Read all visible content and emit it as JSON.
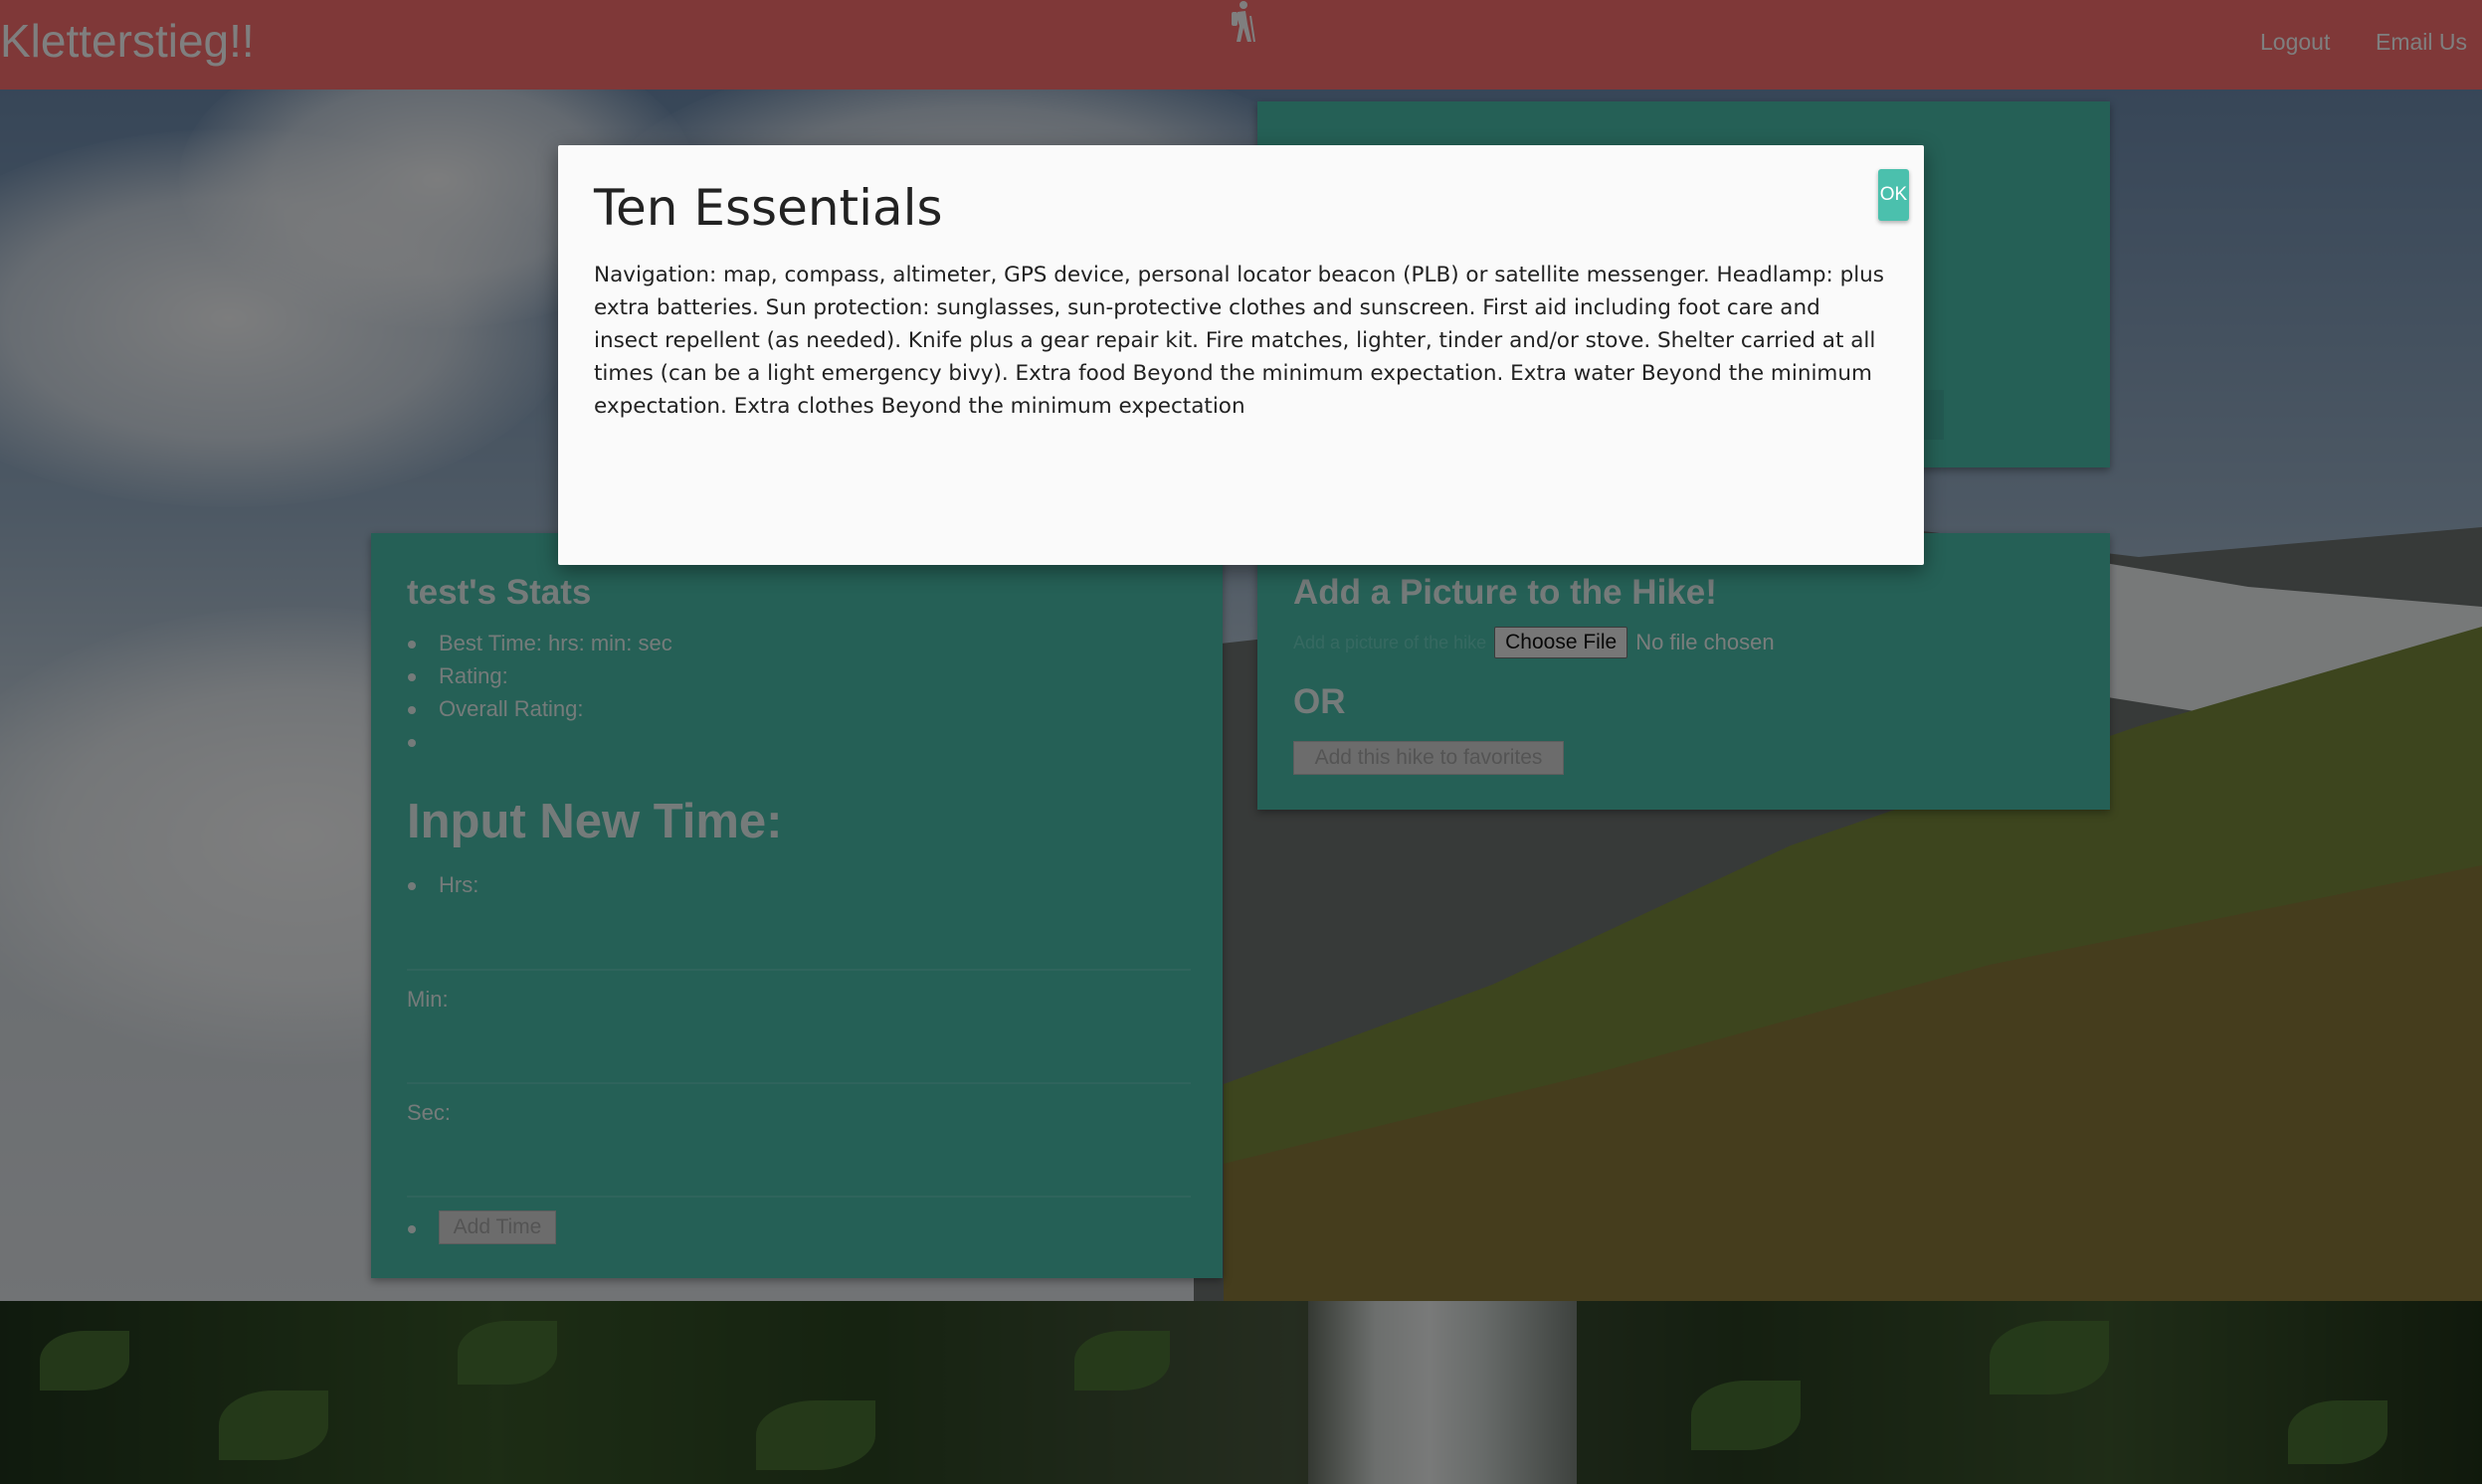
{
  "navbar": {
    "brand": "Kletterstieg!!",
    "logout_label": "Logout",
    "email_label": "Email Us",
    "icon": "hiker-icon"
  },
  "stats_panel": {
    "title": "test's Stats",
    "stats": [
      "Best Time: hrs: min: sec",
      "Rating:",
      "Overall Rating:",
      ""
    ],
    "input_title": "Input New Time:",
    "hrs_label": "Hrs:",
    "min_label": "Min:",
    "sec_label": "Sec:",
    "add_time_label": "Add Time"
  },
  "picture_panel": {
    "title": "Add a Picture to the Hike!",
    "file_hint": "Add a picture of the hike",
    "choose_file_label": "Choose File",
    "file_status": "No file chosen",
    "or_label": "OR",
    "favorites_label": "Add this hike to favorites"
  },
  "modal": {
    "title": "Ten Essentials",
    "body": "Navigation: map, compass, altimeter, GPS device, personal locator beacon (PLB) or satellite messenger. Headlamp: plus extra batteries. Sun protection: sunglasses, sun-protective clothes and sunscreen. First aid including foot care and insect repellent (as needed). Knife plus a gear repair kit. Fire matches, lighter, tinder and/or stove. Shelter carried at all times (can be a light emergency bivy). Extra food Beyond the minimum expectation. Extra water Beyond the minimum expectation. Extra clothes Beyond the minimum expectation",
    "ok_label": "OK"
  },
  "colors": {
    "navbar": "#ff7070",
    "panel": "#4bc0ad",
    "modal_bg": "#fafafa",
    "backdrop": "rgba(0,0,0,0.5)"
  }
}
